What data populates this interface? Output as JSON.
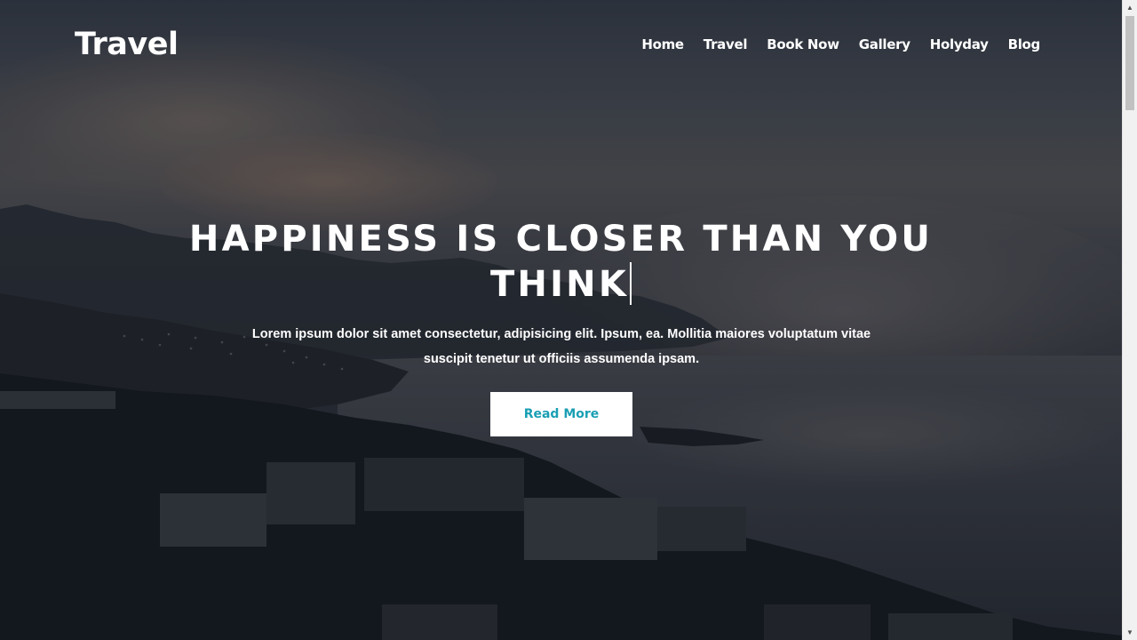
{
  "navbar": {
    "brand": "Travel",
    "links": [
      {
        "label": "Home"
      },
      {
        "label": "Travel"
      },
      {
        "label": "Book Now"
      },
      {
        "label": "Gallery"
      },
      {
        "label": "Holyday"
      },
      {
        "label": "Blog"
      }
    ]
  },
  "hero": {
    "title": "HAPPINESS IS CLOSER THAN YOU THINK",
    "text": "Lorem ipsum dolor sit amet consectetur, adipisicing elit. Ipsum, ea. Mollitia maiores voluptatum vitae suscipit tenetur ut officiis assumenda ipsam.",
    "button_label": "Read More"
  },
  "colors": {
    "accent": "#1a9fb3",
    "text": "#ffffff",
    "button_bg": "#ffffff"
  },
  "scrollbar": {
    "up_icon": "chevron-up-icon",
    "down_icon": "chevron-down-icon"
  }
}
